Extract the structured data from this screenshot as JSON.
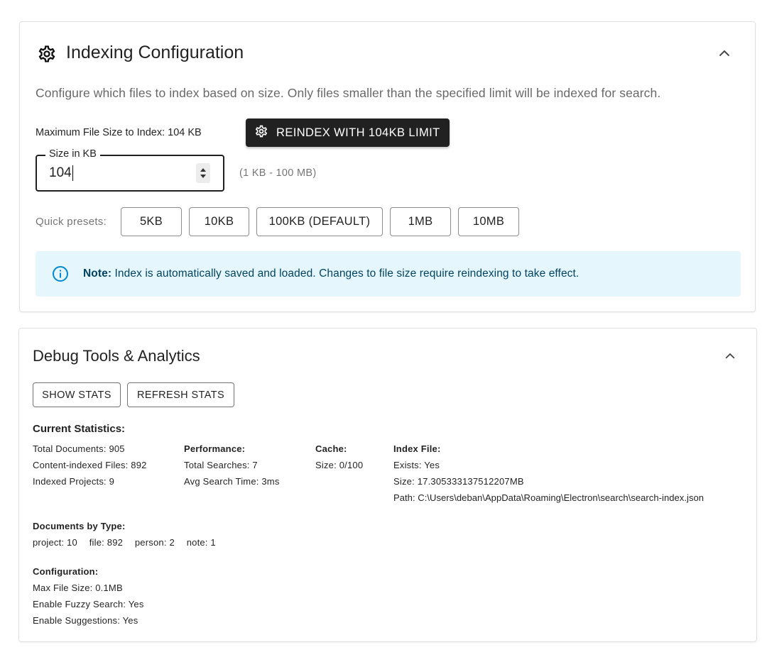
{
  "indexing": {
    "title": "Indexing Configuration",
    "icon": "gear-icon",
    "description": "Configure which files to index based on size. Only files smaller than the specified limit will be indexed for search.",
    "max_size_label": "Maximum File Size to Index: 104 KB",
    "reindex_button": "REINDEX WITH 104KB LIMIT",
    "size_field": {
      "legend": "Size in KB",
      "value": "104",
      "hint": "(1 KB - 100 MB)"
    },
    "presets_label": "Quick presets:",
    "presets": [
      "5KB",
      "10KB",
      "100KB (DEFAULT)",
      "1MB",
      "10MB"
    ],
    "note": {
      "bold": "Note:",
      "text": " Index is automatically saved and loaded. Changes to file size require reindexing to take effect.",
      "color": "#e5f6fd",
      "icon_color": "#0288d1"
    }
  },
  "debug": {
    "title": "Debug Tools & Analytics",
    "show_stats_button": "SHOW STATS",
    "refresh_stats_button": "REFRESH STATS",
    "current_stats_heading": "Current Statistics:",
    "general": {
      "total_documents": "Total Documents: 905",
      "content_indexed": "Content-indexed Files: 892",
      "indexed_projects": "Indexed Projects: 9"
    },
    "performance": {
      "heading": "Performance:",
      "total_searches": "Total Searches: 7",
      "avg_search_time": "Avg Search Time: 3ms"
    },
    "cache": {
      "heading": "Cache:",
      "size": "Size: 0/100"
    },
    "index_file": {
      "heading": "Index File:",
      "exists": "Exists: Yes",
      "size": "Size: 17.305333137512207MB",
      "path": "Path: C:\\Users\\deban\\AppData\\Roaming\\Electron\\search\\search-index.json"
    },
    "documents_by_type": {
      "heading": "Documents by Type:",
      "items": [
        "project: 10",
        "file: 892",
        "person: 2",
        "note: 1"
      ]
    },
    "configuration": {
      "heading": "Configuration:",
      "max_file_size": "Max File Size: 0.1MB",
      "fuzzy_search": "Enable Fuzzy Search: Yes",
      "suggestions": "Enable Suggestions: Yes"
    }
  }
}
